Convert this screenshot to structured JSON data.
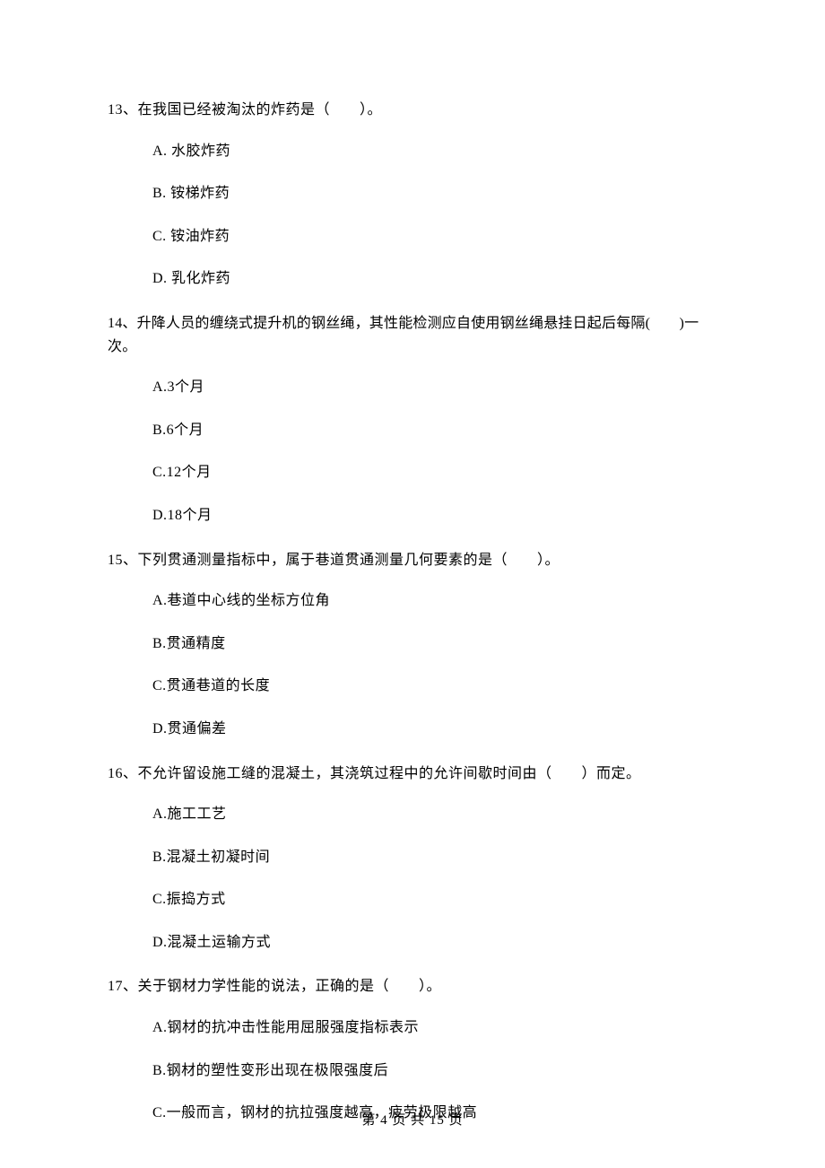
{
  "questions": [
    {
      "num": "13、",
      "text": "在我国已经被淘汰的炸药是（　　）。",
      "options": [
        "A.  水胶炸药",
        "B.  铵梯炸药",
        "C.  铵油炸药",
        "D.  乳化炸药"
      ]
    },
    {
      "num": "14、",
      "text": "升降人员的缠绕式提升机的钢丝绳，其性能检测应自使用钢丝绳悬挂日起后每隔(　　)一次。",
      "options": [
        "A.3个月",
        "B.6个月",
        "C.12个月",
        "D.18个月"
      ]
    },
    {
      "num": "15、",
      "text": "下列贯通测量指标中，属于巷道贯通测量几何要素的是（　　）。",
      "options": [
        "A.巷道中心线的坐标方位角",
        "B.贯通精度",
        "C.贯通巷道的长度",
        "D.贯通偏差"
      ]
    },
    {
      "num": "16、",
      "text": "不允许留设施工缝的混凝土，其浇筑过程中的允许间歇时间由（　　）而定。",
      "options": [
        "A.施工工艺",
        "B.混凝土初凝时间",
        "C.振捣方式",
        "D.混凝土运输方式"
      ]
    },
    {
      "num": "17、",
      "text": "关于钢材力学性能的说法，正确的是（　　）。",
      "options": [
        "A.钢材的抗冲击性能用屈服强度指标表示",
        "B.钢材的塑性变形出现在极限强度后",
        "C.一般而言，钢材的抗拉强度越高，疲劳极限越高"
      ]
    }
  ],
  "footer": "第 4 页 共 15 页"
}
